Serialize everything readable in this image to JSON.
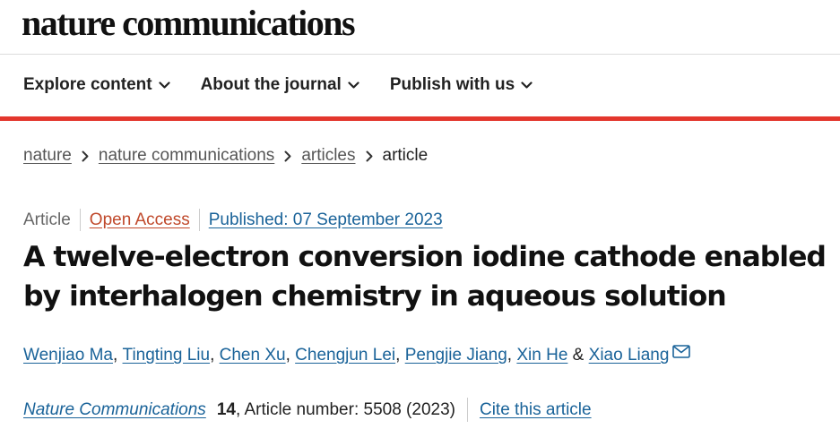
{
  "site": {
    "logo": "nature communications"
  },
  "nav": {
    "items": [
      {
        "label": "Explore content"
      },
      {
        "label": "About the journal"
      },
      {
        "label": "Publish with us"
      }
    ]
  },
  "breadcrumb": {
    "items": [
      "nature",
      "nature communications",
      "articles"
    ],
    "current": "article"
  },
  "meta": {
    "type": "Article",
    "access": "Open Access",
    "published": "Published: 07 September 2023"
  },
  "article": {
    "title_line1": "A twelve-electron conversion iodine cathode enabled",
    "title_line2": "by interhalogen chemistry in aqueous solution"
  },
  "authors": {
    "list": [
      "Wenjiao Ma",
      "Tingting Liu",
      "Chen Xu",
      "Chengjun Lei",
      "Pengjie Jiang",
      "Xin He",
      "Xiao Liang"
    ],
    "comma": ",",
    "ampersand": "&"
  },
  "citation": {
    "journal": "Nature Communications",
    "volume": "14",
    "article_number": ", Article number: 5508 (2023)",
    "cite_label": "Cite this article"
  },
  "colors": {
    "accent_red": "#e3362d",
    "link_blue": "#1a6399",
    "open_access": "#c0492b"
  },
  "icons": [
    "chevron-down-icon",
    "chevron-right-icon",
    "mail-icon"
  ]
}
